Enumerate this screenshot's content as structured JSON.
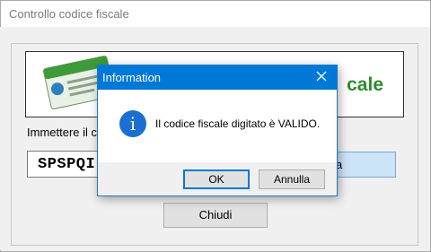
{
  "window": {
    "title": "Controllo codice fiscale"
  },
  "main": {
    "banner_text": "cale",
    "prompt_label": "Immettere il co",
    "code_value": "SPSPQI",
    "verify_label": "a",
    "close_label": "Chiudi"
  },
  "dialog": {
    "title": "Information",
    "icon": "info-icon",
    "message": "Il codice fiscale digitato è VALIDO.",
    "ok_label": "OK",
    "cancel_label": "Annulla"
  },
  "colors": {
    "accent": "#0078d7",
    "banner_green": "#2e8b2e",
    "info_icon": "#1a6fd1"
  }
}
